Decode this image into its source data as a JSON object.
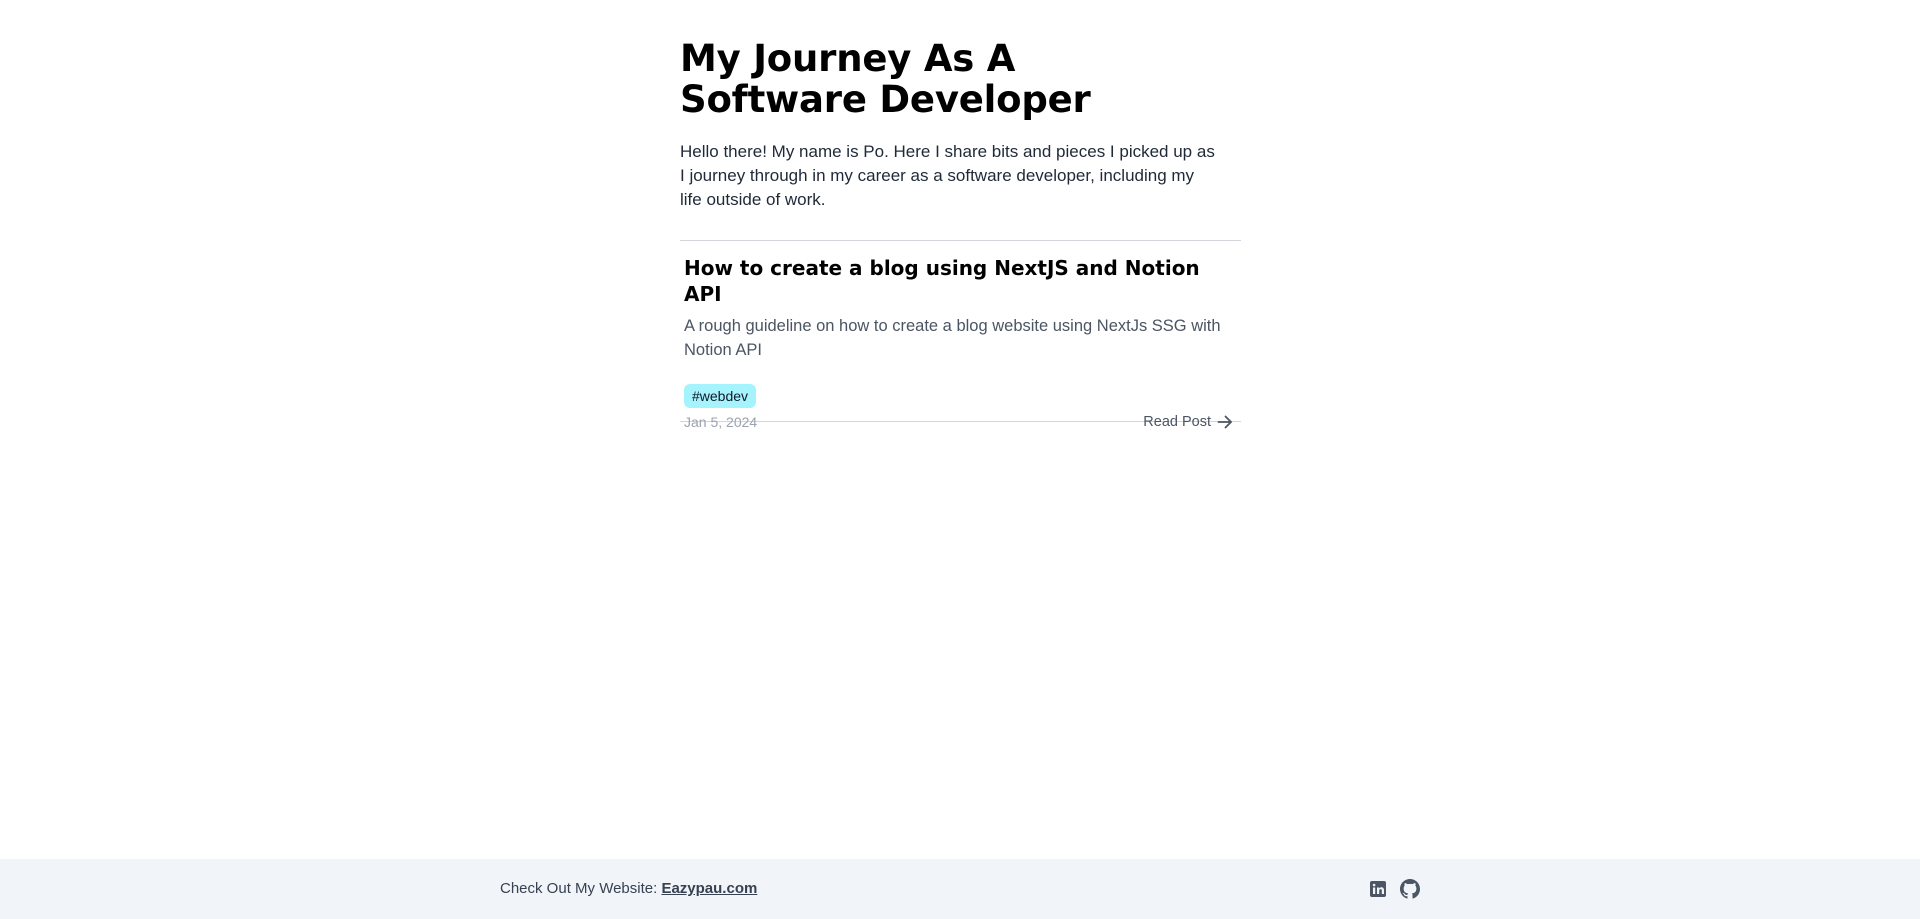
{
  "header": {
    "title": "My Journey As A Software Developer",
    "intro": "Hello there! My name is Po. Here I share bits and pieces I picked up as I journey through in my career as a software developer, including my life outside of work."
  },
  "posts": [
    {
      "title": "How to create a blog using NextJS and Notion API",
      "description": "A rough guideline on how to create a blog website using NextJs SSG with Notion API",
      "tags": [
        "#webdev"
      ],
      "date": "Jan 5, 2024",
      "read_label": "Read Post",
      "read_icon": "arrow-right-icon"
    }
  ],
  "footer": {
    "prefix": "Check Out My Website: ",
    "link_text": "Eazypau.com",
    "social": [
      {
        "icon": "linkedin-icon"
      },
      {
        "icon": "github-icon"
      }
    ]
  },
  "colors": {
    "tag_background": "#a5f3fc",
    "footer_background": "#f1f5f9",
    "divider": "#d1d5db"
  }
}
